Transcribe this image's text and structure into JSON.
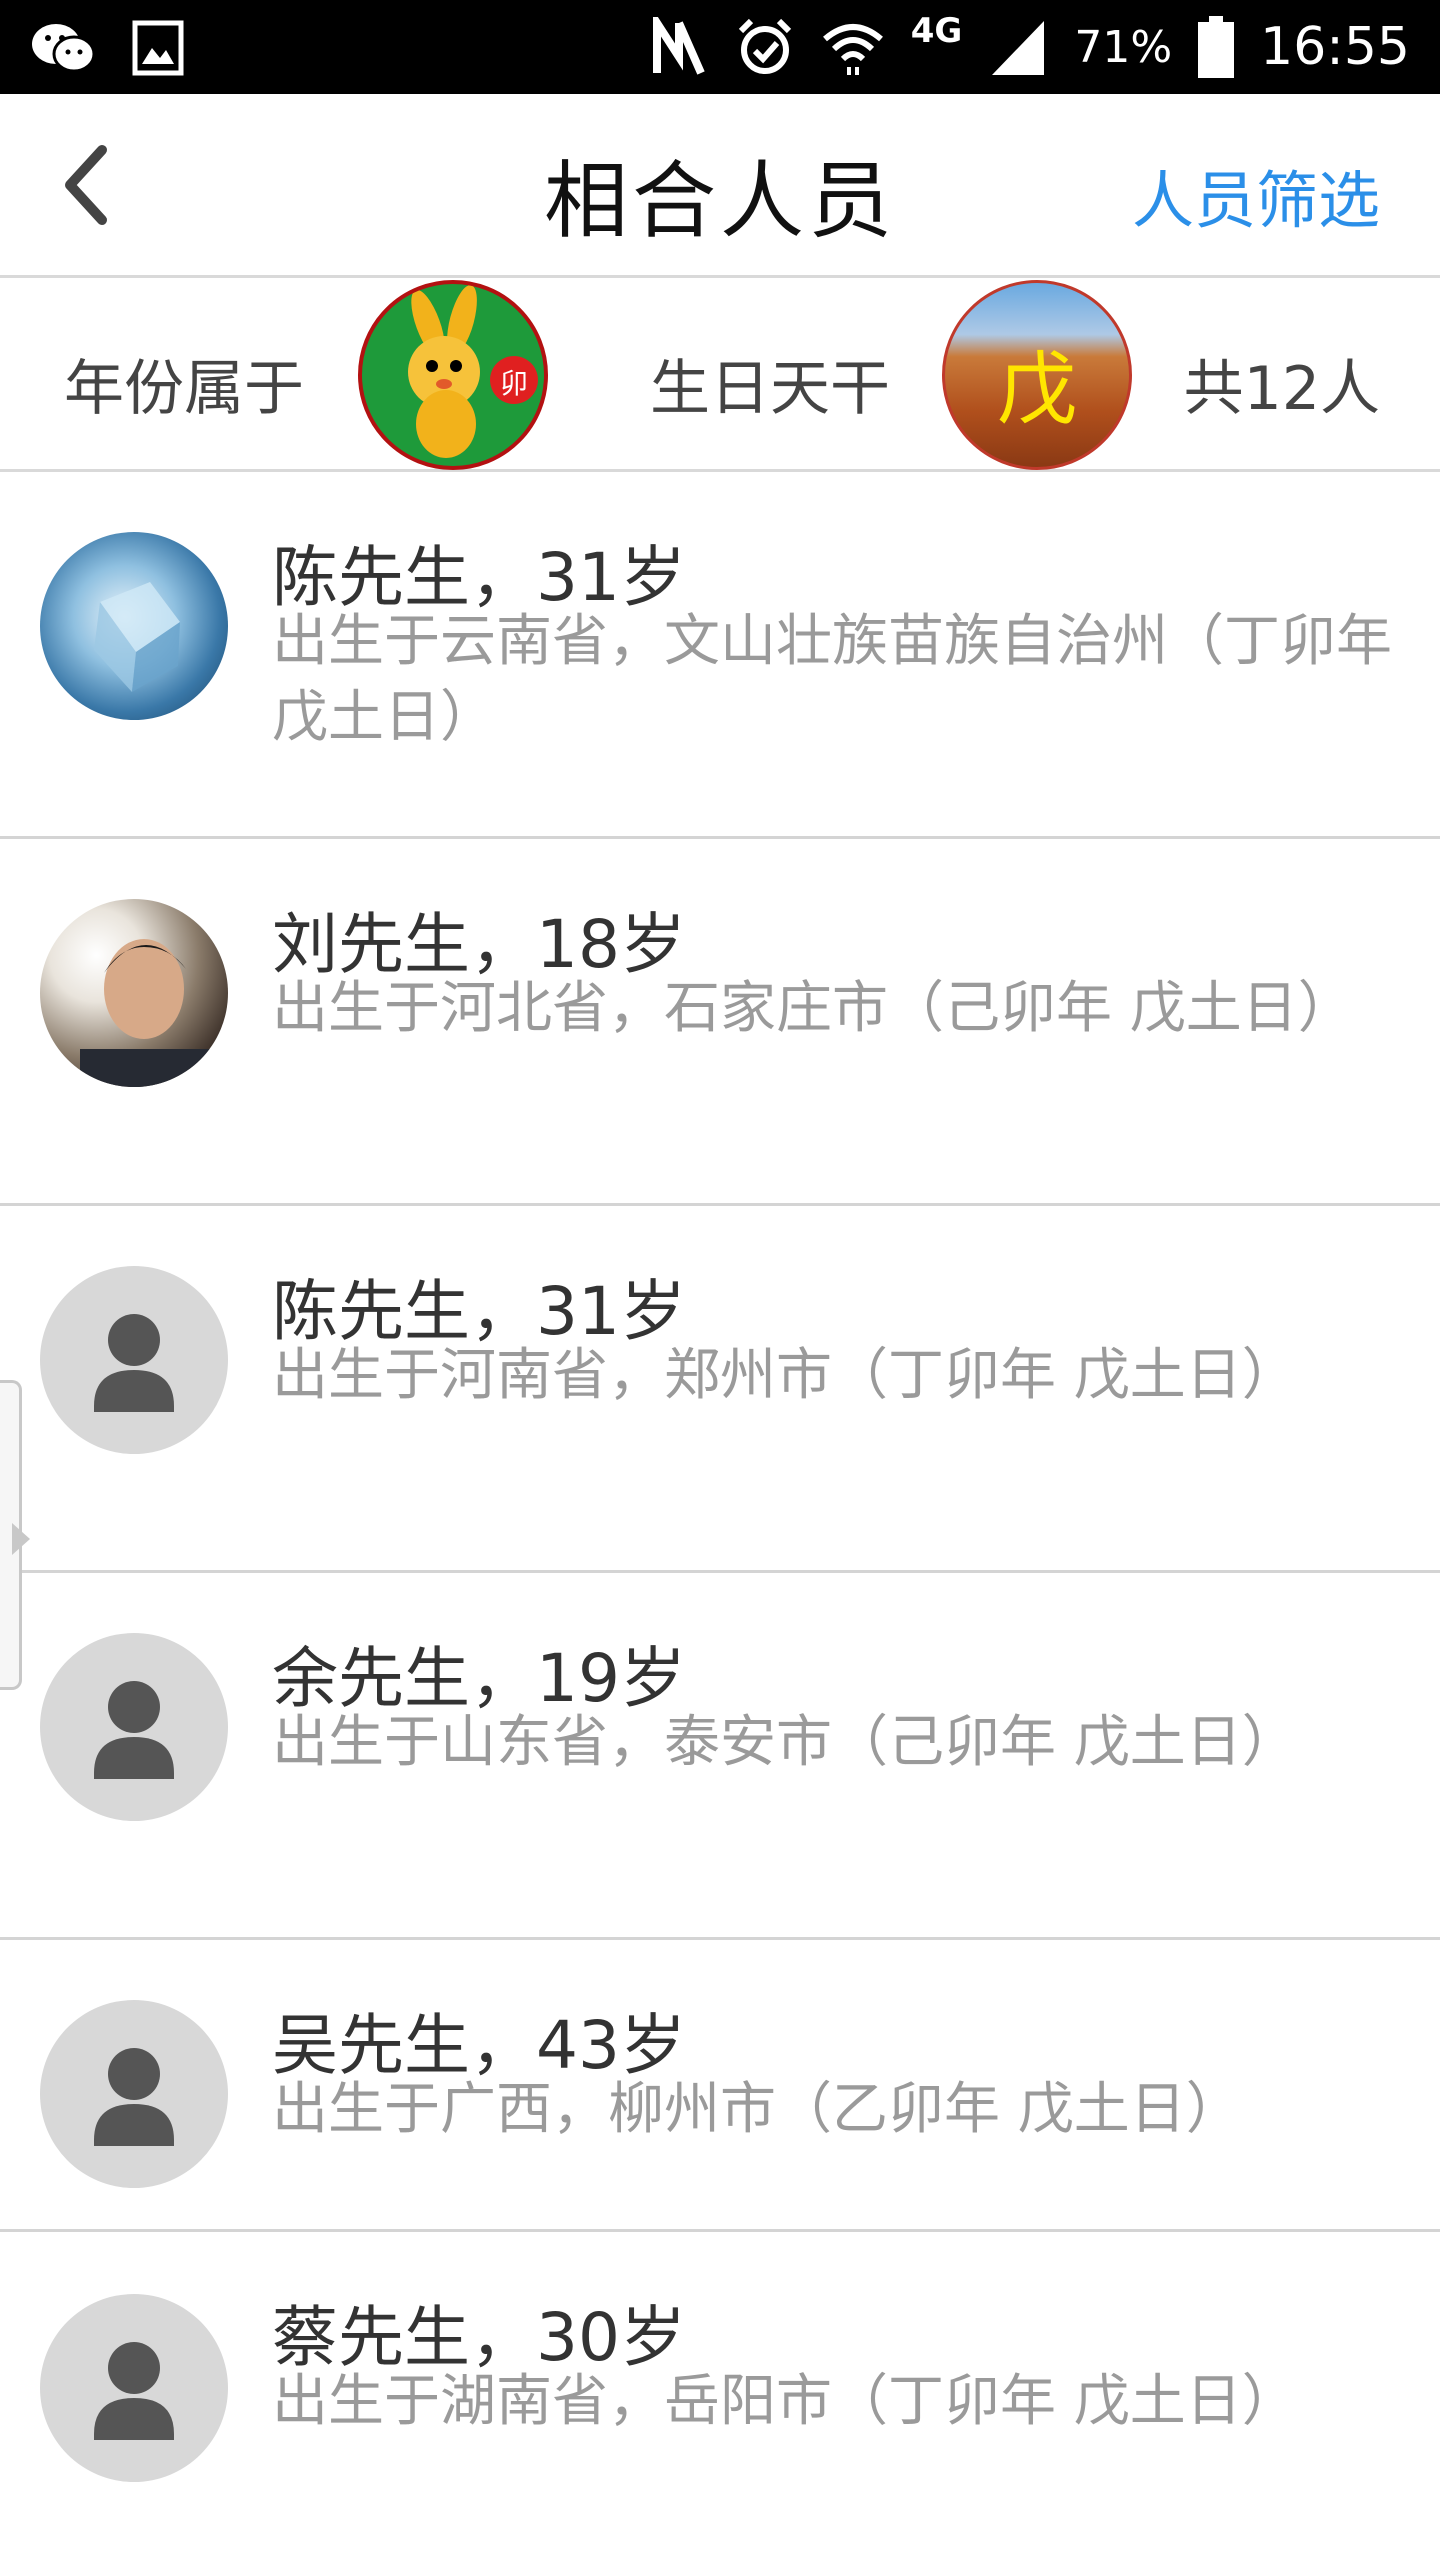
{
  "status_bar": {
    "left_icons": [
      "wechat-icon",
      "image-icon"
    ],
    "right_icons": [
      "nfc-icon",
      "alarm-icon",
      "wifi-icon",
      "signal-icon",
      "battery-icon"
    ],
    "network": "4G",
    "battery": "71%",
    "time": "16:55"
  },
  "header": {
    "title": "相合人员",
    "filter_label": "人员筛选",
    "accent_color": "#2b8fe8"
  },
  "summary": {
    "year_label": "年份属于",
    "year_badge_char": "卯",
    "day_label": "生日天干",
    "day_badge_char": "戊",
    "total": "共12人"
  },
  "people": [
    {
      "name": "陈先生，31岁",
      "info": "出生于云南省，文山壮族苗族自治州（丁卯年 戊土日）",
      "avatar": "ice-photo"
    },
    {
      "name": "刘先生，18岁",
      "info": "出生于河北省，石家庄市（己卯年 戊土日）",
      "avatar": "face-photo"
    },
    {
      "name": "陈先生，31岁",
      "info": "出生于河南省，郑州市（丁卯年 戊土日）",
      "avatar": "default-user-icon"
    },
    {
      "name": "余先生，19岁",
      "info": "出生于山东省，泰安市（己卯年 戊土日）",
      "avatar": "default-user-icon"
    },
    {
      "name": "吴先生，43岁",
      "info": "出生于广西，柳州市（乙卯年 戊土日）",
      "avatar": "default-user-icon"
    },
    {
      "name": "蔡先生，30岁",
      "info": "出生于湖南省，岳阳市（丁卯年 戊土日）",
      "avatar": "default-user-icon"
    }
  ]
}
